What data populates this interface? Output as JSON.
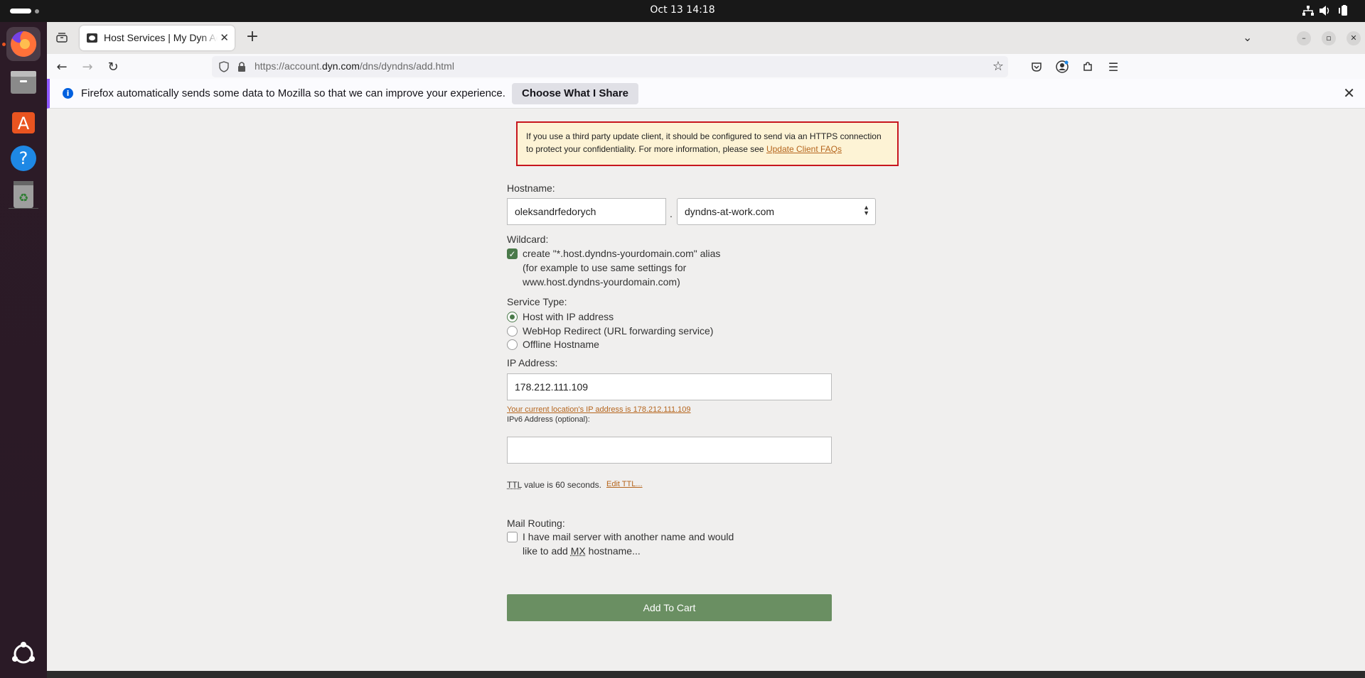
{
  "system": {
    "clock": "Oct 13  14:18"
  },
  "browser": {
    "tab_title": "Host Services | My Dyn Account",
    "url_prefix": "https://account.",
    "url_domain": "dyn.com",
    "url_path": "/dns/dyndns/add.html"
  },
  "notice": {
    "message": "Firefox automatically sends some data to Mozilla so that we can improve your experience.",
    "button": "Choose What I Share"
  },
  "warning": {
    "text": "If you use a third party update client, it should be configured to send via an HTTPS connection to protect your confidentiality. For more information, please see ",
    "link": "Update Client FAQs"
  },
  "form": {
    "hostname_label": "Hostname:",
    "hostname_value": "oleksandrfedorych",
    "separator": ".",
    "domain_value": "dyndns-at-work.com",
    "wildcard_label": "Wildcard:",
    "wildcard_line1": "create \"*.host.dyndns-yourdomain.com\" alias",
    "wildcard_line2": "(for example to use same settings for",
    "wildcard_line3": "www.host.dyndns-yourdomain.com)",
    "service_type_label": "Service Type:",
    "service_options": [
      "Host with IP address",
      "WebHop Redirect (URL forwarding service)",
      "Offline Hostname"
    ],
    "ip_label": "IP Address:",
    "ip_value": "178.212.111.109",
    "ip_hint": "Your current location's IP address is 178.212.111.109",
    "ipv6_label": "IPv6 Address (optional):",
    "ipv6_value": "",
    "ttl_abbr": "TTL",
    "ttl_text": " value is 60 seconds.",
    "ttl_edit": "Edit TTL...",
    "mail_label": "Mail Routing:",
    "mail_line1": "I have mail server with another name and would",
    "mail_line2_pre": "like to add ",
    "mail_line2_abbr": "MX",
    "mail_line2_post": " hostname...",
    "submit": "Add To Cart"
  },
  "colors": {
    "accent_green": "#6a8f62",
    "warning_border": "#c7161e",
    "warning_bg": "#fdf3d5",
    "link": "#b5651d"
  }
}
